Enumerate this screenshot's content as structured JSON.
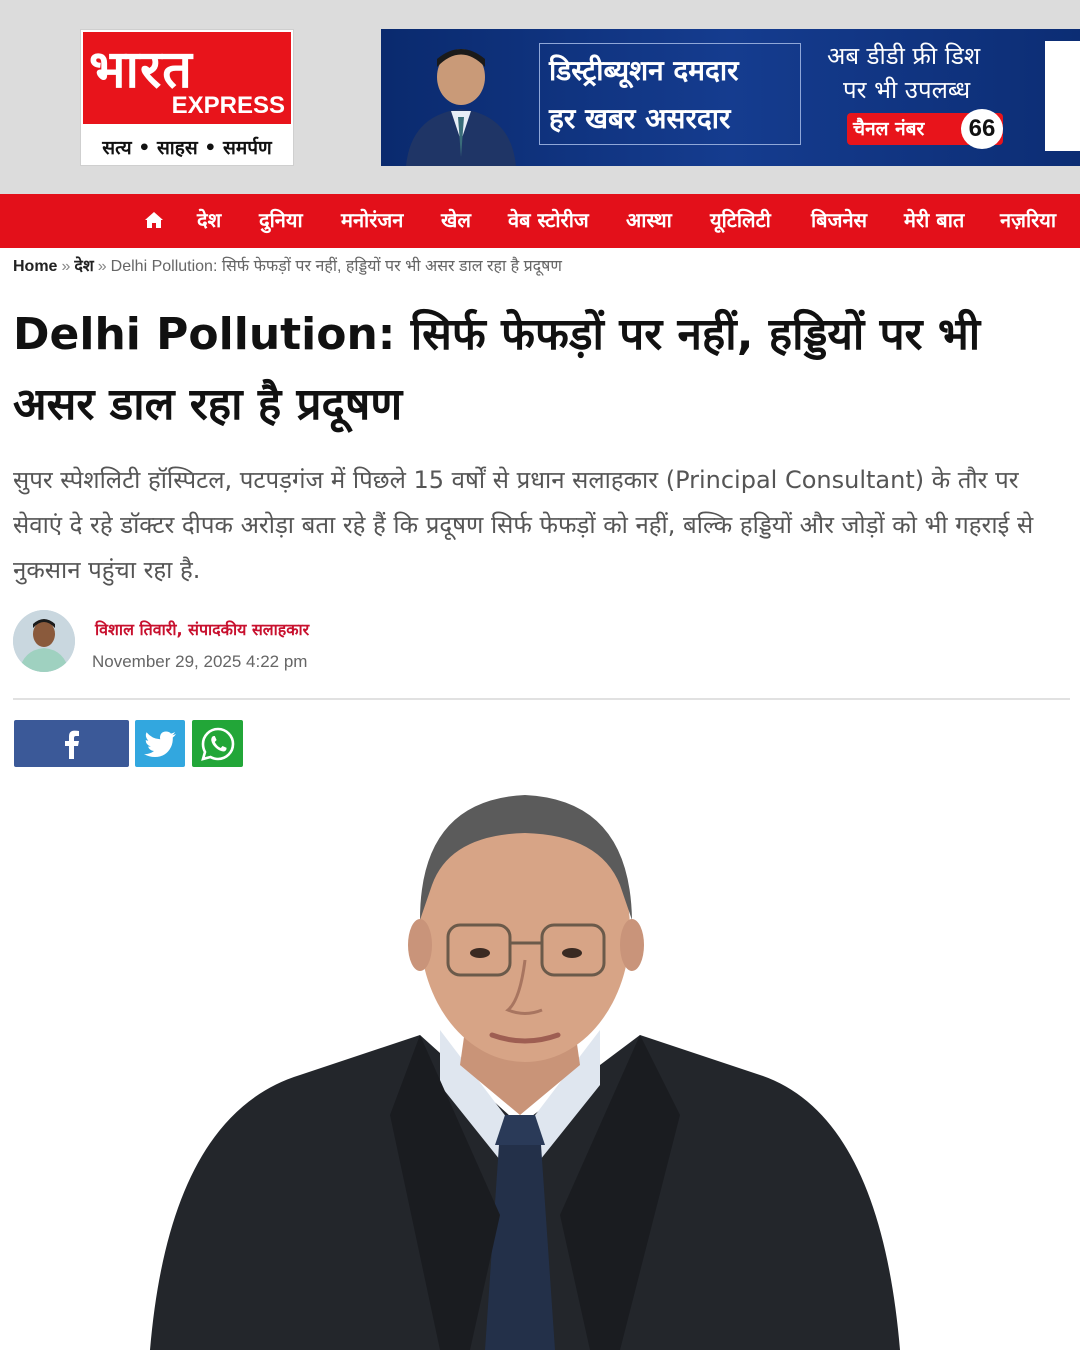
{
  "header": {
    "logo": {
      "hindi": "भारत",
      "english": "EXPRESS",
      "tagline": "सत्य • साहस • समर्पण"
    },
    "banner": {
      "line1": "डिस्ट्रीब्यूशन दमदार",
      "line2": "हर खबर असरदार",
      "right_line1": "अब डीडी फ्री डिश",
      "right_line2": "पर भी उपलब्ध",
      "channel_label": "चैनल नंबर",
      "channel_number": "66"
    }
  },
  "nav": {
    "home_icon": "home-icon",
    "items": [
      "देश",
      "दुनिया",
      "मनोरंजन",
      "खेल",
      "वेब स्टोरीज",
      "आस्था",
      "यूटिलिटी",
      "बिजनेस",
      "मेरी बात",
      "नज़रिया"
    ]
  },
  "breadcrumb": {
    "home": "Home",
    "separator": "»",
    "category": "देश",
    "current": "Delhi Pollution: सिर्फ फेफड़ों पर नहीं, हड्डियों पर भी असर डाल रहा है प्रदूषण"
  },
  "article": {
    "headline": "Delhi Pollution: सिर्फ फेफड़ों पर नहीं, हड्डियों पर भी असर डाल रहा है प्रदूषण",
    "lede": "सुपर स्पेशलिटी हॉस्पिटल, पटपड़गंज में पिछले 15 वर्षों से प्रधान सलाहकार (Principal Consultant) के तौर पर सेवाएं दे रहे डॉक्टर दीपक अरोड़ा बता रहे हैं कि प्रदूषण सिर्फ फेफड़ों को नहीं, बल्कि हड्डियों और जोड़ों को भी गहराई से नुकसान पहुंचा रहा है.",
    "author": "विशाल तिवारी, संपादकीय सलाहकार",
    "date": "November 29, 2025 4:22 pm"
  },
  "share": {
    "icons": [
      "facebook-icon",
      "twitter-icon",
      "whatsapp-icon"
    ]
  },
  "colors": {
    "brand_red": "#e3101a",
    "facebook": "#3b5998",
    "twitter": "#32a7df",
    "whatsapp": "#22a638",
    "author_red": "#c8102e"
  }
}
